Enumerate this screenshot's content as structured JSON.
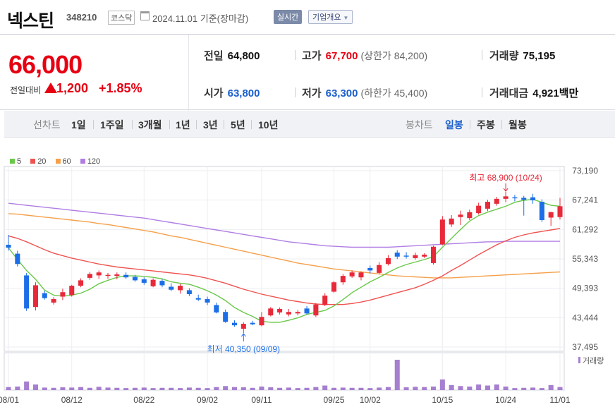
{
  "header": {
    "name": "넥스틴",
    "code": "348210",
    "market": "코스닥",
    "date": "2024.11.01",
    "basis": "기준(장마감)",
    "realtime_btn": "실시간",
    "overview_btn": "기업개요"
  },
  "price": {
    "current": "66,000",
    "change_label": "전일대비",
    "change": "1,200",
    "change_pct": "+1.85%"
  },
  "info": {
    "prev_close_label": "전일",
    "prev_close": "64,800",
    "high_label": "고가",
    "high": "67,700",
    "upper_limit_text": "(상한가 84,200)",
    "volume_label": "거래량",
    "volume": "75,195",
    "open_label": "시가",
    "open": "63,800",
    "low_label": "저가",
    "low": "63,300",
    "lower_limit_text": "(하한가 45,400)",
    "trade_value_label": "거래대금",
    "trade_value": "4,921",
    "trade_value_unit": "백만"
  },
  "periodbar": {
    "line_label": "선차트",
    "line_periods": [
      "1일",
      "1주일",
      "3개월",
      "1년",
      "3년",
      "5년",
      "10년"
    ],
    "candle_label": "봉차트",
    "candle_periods": [
      "일봉",
      "주봉",
      "월봉"
    ],
    "active": "일봉"
  },
  "colors": {
    "up": "#e8293a",
    "down": "#1c6ee8",
    "ma5": "#6ac849",
    "ma20": "#ef5350",
    "ma60": "#f5a04a",
    "ma120": "#b07ee3",
    "volume": "#a67fd0"
  },
  "chart_data": {
    "type": "candlestick",
    "legend": [
      "5",
      "20",
      "60",
      "120"
    ],
    "y_ticks": [
      "73,190",
      "67,241",
      "61,292",
      "55,343",
      "49,393",
      "43,444",
      "37,495"
    ],
    "ylim": [
      37495,
      73190
    ],
    "x_tick_labels": [
      "08/01",
      "08/12",
      "08/22",
      "09/02",
      "09/11",
      "09/25",
      "10/02",
      "10/15",
      "10/24",
      "11/01"
    ],
    "x_tick_index": [
      0,
      7,
      15,
      22,
      28,
      36,
      40,
      48,
      55,
      61
    ],
    "annotation_high": "최고 68,900 (10/24)",
    "annotation_high_index": 55,
    "annotation_high_value": 68900,
    "annotation_low": "최저 40,350 (09/09)",
    "annotation_low_index": 26,
    "annotation_low_value": 40350,
    "volume_label": "거래량",
    "candles": [
      {
        "o": 58200,
        "h": 60200,
        "l": 57000,
        "c": 57600
      },
      {
        "o": 56400,
        "h": 57000,
        "l": 53800,
        "c": 54300
      },
      {
        "o": 52000,
        "h": 52500,
        "l": 44800,
        "c": 45300
      },
      {
        "o": 45600,
        "h": 50600,
        "l": 44900,
        "c": 50000
      },
      {
        "o": 48400,
        "h": 48900,
        "l": 47100,
        "c": 47400
      },
      {
        "o": 46500,
        "h": 47600,
        "l": 46100,
        "c": 47200
      },
      {
        "o": 47700,
        "h": 49300,
        "l": 47000,
        "c": 48600
      },
      {
        "o": 48000,
        "h": 50100,
        "l": 47700,
        "c": 49900
      },
      {
        "o": 49900,
        "h": 51400,
        "l": 49600,
        "c": 51000
      },
      {
        "o": 51500,
        "h": 52700,
        "l": 51100,
        "c": 52300
      },
      {
        "o": 52000,
        "h": 53000,
        "l": 51300,
        "c": 52600
      },
      {
        "o": 51900,
        "h": 52500,
        "l": 51300,
        "c": 52100
      },
      {
        "o": 51900,
        "h": 52600,
        "l": 51200,
        "c": 52200
      },
      {
        "o": 52100,
        "h": 52600,
        "l": 51300,
        "c": 51600
      },
      {
        "o": 51700,
        "h": 52100,
        "l": 50700,
        "c": 51000
      },
      {
        "o": 51200,
        "h": 51600,
        "l": 50100,
        "c": 50500
      },
      {
        "o": 49800,
        "h": 51400,
        "l": 49600,
        "c": 51100
      },
      {
        "o": 50900,
        "h": 51300,
        "l": 49600,
        "c": 50000
      },
      {
        "o": 49700,
        "h": 50400,
        "l": 48800,
        "c": 49100
      },
      {
        "o": 49000,
        "h": 50300,
        "l": 48300,
        "c": 49900
      },
      {
        "o": 49000,
        "h": 49400,
        "l": 47800,
        "c": 48200
      },
      {
        "o": 47400,
        "h": 48100,
        "l": 46800,
        "c": 47100
      },
      {
        "o": 47200,
        "h": 47700,
        "l": 46000,
        "c": 46500
      },
      {
        "o": 46000,
        "h": 46500,
        "l": 44300,
        "c": 44500
      },
      {
        "o": 44600,
        "h": 45100,
        "l": 42400,
        "c": 42600
      },
      {
        "o": 42400,
        "h": 42900,
        "l": 41600,
        "c": 41900
      },
      {
        "o": 41200,
        "h": 42500,
        "l": 40350,
        "c": 42200
      },
      {
        "o": 42400,
        "h": 42800,
        "l": 41900,
        "c": 42100
      },
      {
        "o": 41900,
        "h": 44600,
        "l": 41700,
        "c": 43600
      },
      {
        "o": 43900,
        "h": 45600,
        "l": 43700,
        "c": 45300
      },
      {
        "o": 44500,
        "h": 45500,
        "l": 44100,
        "c": 45200
      },
      {
        "o": 44100,
        "h": 45200,
        "l": 43700,
        "c": 44600
      },
      {
        "o": 44300,
        "h": 45000,
        "l": 43900,
        "c": 44600
      },
      {
        "o": 45300,
        "h": 45800,
        "l": 44100,
        "c": 44300
      },
      {
        "o": 43900,
        "h": 46400,
        "l": 43600,
        "c": 46100
      },
      {
        "o": 46000,
        "h": 48400,
        "l": 45800,
        "c": 47900
      },
      {
        "o": 48700,
        "h": 50900,
        "l": 48500,
        "c": 50600
      },
      {
        "o": 50600,
        "h": 52300,
        "l": 50100,
        "c": 51900
      },
      {
        "o": 51800,
        "h": 53000,
        "l": 51500,
        "c": 52600
      },
      {
        "o": 51600,
        "h": 52800,
        "l": 51000,
        "c": 52600
      },
      {
        "o": 53500,
        "h": 54000,
        "l": 52400,
        "c": 53000
      },
      {
        "o": 52500,
        "h": 54700,
        "l": 52200,
        "c": 54100
      },
      {
        "o": 54300,
        "h": 56100,
        "l": 54000,
        "c": 55500
      },
      {
        "o": 56600,
        "h": 57100,
        "l": 55300,
        "c": 55800
      },
      {
        "o": 56000,
        "h": 56700,
        "l": 55400,
        "c": 55800
      },
      {
        "o": 55500,
        "h": 56600,
        "l": 55200,
        "c": 56100
      },
      {
        "o": 55800,
        "h": 56500,
        "l": 55500,
        "c": 56200
      },
      {
        "o": 54500,
        "h": 58000,
        "l": 54200,
        "c": 57800
      },
      {
        "o": 58300,
        "h": 64000,
        "l": 58100,
        "c": 63300
      },
      {
        "o": 62300,
        "h": 64200,
        "l": 61800,
        "c": 63500
      },
      {
        "o": 63800,
        "h": 65100,
        "l": 62200,
        "c": 64300
      },
      {
        "o": 63600,
        "h": 65300,
        "l": 63200,
        "c": 64800
      },
      {
        "o": 64600,
        "h": 66700,
        "l": 64300,
        "c": 66100
      },
      {
        "o": 65500,
        "h": 67300,
        "l": 65000,
        "c": 66900
      },
      {
        "o": 66500,
        "h": 67900,
        "l": 66100,
        "c": 67500
      },
      {
        "o": 67500,
        "h": 68900,
        "l": 66800,
        "c": 68000
      },
      {
        "o": 67800,
        "h": 68300,
        "l": 67000,
        "c": 67600
      },
      {
        "o": 67700,
        "h": 68100,
        "l": 64100,
        "c": 67300
      },
      {
        "o": 67800,
        "h": 68500,
        "l": 66500,
        "c": 67200
      },
      {
        "o": 66900,
        "h": 67400,
        "l": 62800,
        "c": 63200
      },
      {
        "o": 63700,
        "h": 64900,
        "l": 62000,
        "c": 64800
      },
      {
        "o": 63800,
        "h": 67700,
        "l": 63300,
        "c": 66000
      }
    ],
    "volumes": [
      12,
      14,
      34,
      22,
      10,
      9,
      11,
      10,
      12,
      9,
      13,
      10,
      9,
      8,
      9,
      10,
      8,
      9,
      9,
      8,
      10,
      9,
      8,
      12,
      16,
      12,
      11,
      9,
      14,
      11,
      9,
      10,
      8,
      9,
      12,
      18,
      9,
      10,
      9,
      9,
      8,
      10,
      12,
      120,
      11,
      13,
      12,
      14,
      42,
      20,
      16,
      14,
      22,
      18,
      22,
      14,
      8,
      9,
      10,
      8,
      20,
      12
    ],
    "ma5": [
      57600,
      55200,
      53000,
      51200,
      49000,
      48000,
      47800,
      48000,
      48400,
      49200,
      50300,
      51000,
      51600,
      51900,
      51900,
      51800,
      51600,
      51300,
      50700,
      50400,
      50200,
      49600,
      48900,
      48000,
      46900,
      45500,
      44500,
      43700,
      42700,
      42500,
      42500,
      42900,
      43400,
      44100,
      44500,
      44900,
      45800,
      47100,
      48500,
      49600,
      50700,
      51600,
      52600,
      53500,
      54200,
      54700,
      55200,
      55800,
      57700,
      59500,
      61300,
      63000,
      64100,
      64800,
      65400,
      66000,
      66800,
      67200,
      67400,
      66800,
      66200,
      66000
    ],
    "ma20": [
      60000,
      59500,
      58800,
      58000,
      57200,
      56500,
      56000,
      55500,
      55100,
      54700,
      54300,
      54000,
      53700,
      53500,
      53300,
      53100,
      52900,
      52700,
      52500,
      52300,
      52100,
      51800,
      51400,
      50900,
      50400,
      49800,
      49200,
      48700,
      48200,
      47800,
      47400,
      47000,
      46700,
      46400,
      46200,
      46100,
      46100,
      46100,
      46300,
      46600,
      47000,
      47500,
      48000,
      48500,
      49000,
      49500,
      50200,
      51000,
      51900,
      53000,
      54000,
      55100,
      56200,
      57200,
      58200,
      59000,
      59700,
      60200,
      60600,
      60900,
      61200,
      61500
    ],
    "ma60": [
      64500,
      64400,
      64200,
      64000,
      63800,
      63600,
      63400,
      63200,
      63000,
      62800,
      62500,
      62300,
      62000,
      61700,
      61400,
      61100,
      60800,
      60400,
      60000,
      59700,
      59300,
      58900,
      58500,
      58100,
      57700,
      57300,
      56900,
      56500,
      56100,
      55700,
      55300,
      54900,
      54500,
      54200,
      53900,
      53600,
      53300,
      53100,
      52900,
      52700,
      52500,
      52300,
      52100,
      51900,
      51800,
      51700,
      51600,
      51500,
      51500,
      51500,
      51600,
      51700,
      51800,
      51900,
      52000,
      52100,
      52200,
      52300,
      52400,
      52500,
      52600,
      52700
    ],
    "ma120": [
      66600,
      66400,
      66200,
      66000,
      65800,
      65600,
      65400,
      65200,
      65000,
      64800,
      64600,
      64400,
      64200,
      64000,
      63800,
      63600,
      63300,
      63000,
      62700,
      62400,
      62100,
      61800,
      61500,
      61200,
      60900,
      60600,
      60300,
      60000,
      59700,
      59400,
      59100,
      58800,
      58600,
      58400,
      58200,
      58000,
      57900,
      57800,
      57700,
      57700,
      57700,
      57700,
      57700,
      57800,
      57900,
      58000,
      58100,
      58200,
      58300,
      58400,
      58500,
      58600,
      58700,
      58800,
      58800,
      58900,
      58900,
      58900,
      58900,
      58900,
      58900,
      58900
    ]
  }
}
